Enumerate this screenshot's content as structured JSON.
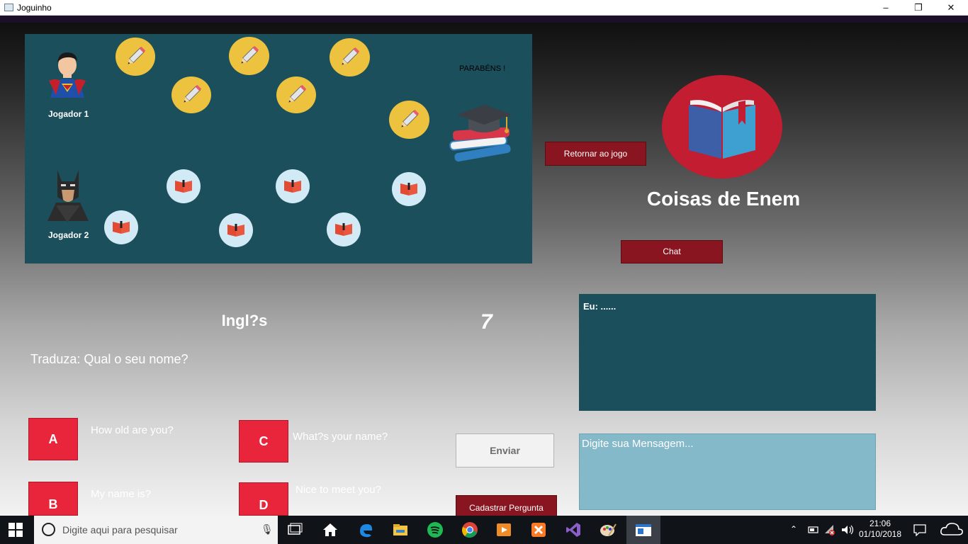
{
  "window": {
    "title": "Joguinho",
    "minimize_glyph": "–",
    "maximize_glyph": "❐",
    "close_glyph": "✕"
  },
  "board": {
    "player1_label": "Jogador 1",
    "player2_label": "Jogador 2",
    "congrats_text": "PARABÉNS !"
  },
  "buttons": {
    "return_label": "Retornar ao jogo",
    "chat_label": "Chat",
    "send_label": "Enviar",
    "register_label": "Cadastrar Pergunta"
  },
  "brand": {
    "title": "Coisas de Enem",
    "logo_icon": "open-book-icon"
  },
  "quiz": {
    "subject": "Ingl?s",
    "timer": "7",
    "question": "Traduza: Qual o seu nome?",
    "options": [
      {
        "letter": "A",
        "text": "How old are you?"
      },
      {
        "letter": "B",
        "text": "My name is?"
      },
      {
        "letter": "C",
        "text": "What?s your name?"
      },
      {
        "letter": "D",
        "text": "Nice to meet you?"
      }
    ]
  },
  "chat": {
    "log_text": "Eu: ......",
    "input_placeholder": "Digite sua Mensagem..."
  },
  "taskbar": {
    "search_placeholder": "Digite aqui para pesquisar",
    "time": "21:06",
    "date": "01/10/2018"
  },
  "colors": {
    "board": "#1b4f5c",
    "accent_red": "#e8253a",
    "dark_red": "#88151f",
    "logo_red": "#c21d30",
    "pencil_chip": "#ecc23f",
    "book_chip": "#d2eaf5",
    "chat_input": "#84b9c9"
  }
}
